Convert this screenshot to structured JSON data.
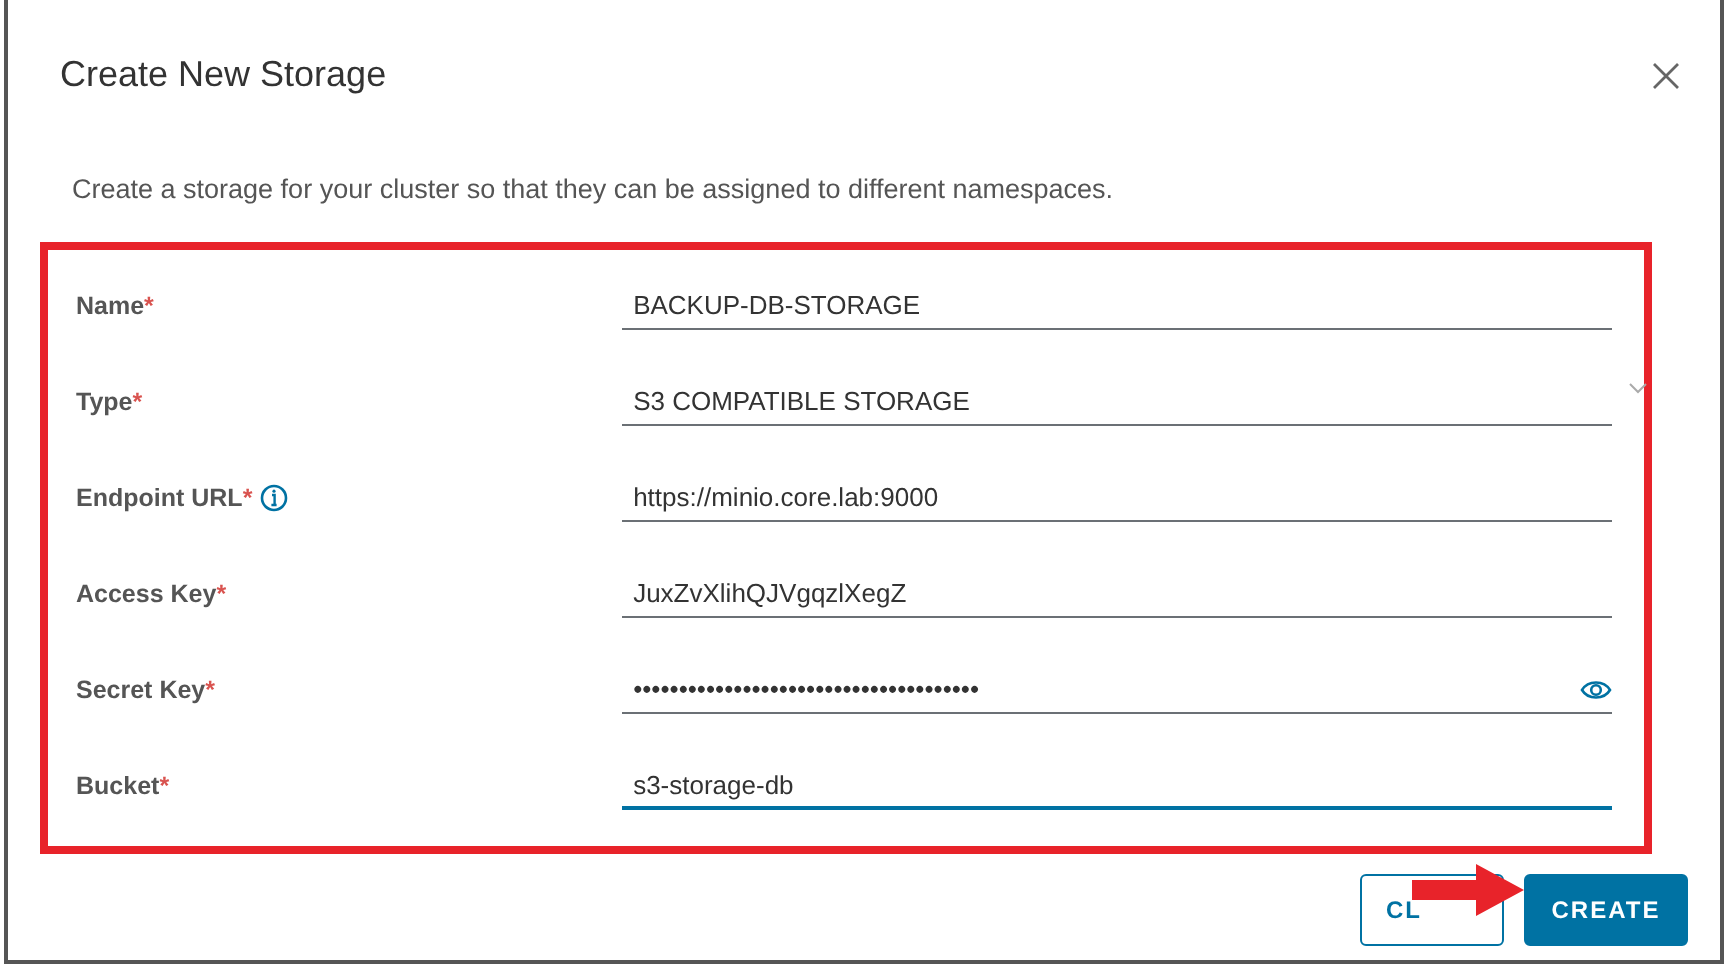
{
  "dialog": {
    "title": "Create New Storage",
    "description": "Create a storage for your cluster so that they can be assigned to different namespaces."
  },
  "fields": [
    {
      "label": "Name",
      "kind": "text",
      "value": "BACKUP-DB-STORAGE",
      "focused": false
    },
    {
      "label": "Type",
      "kind": "select",
      "value": "S3 COMPATIBLE STORAGE",
      "focused": false
    },
    {
      "label": "Endpoint URL",
      "kind": "text",
      "value": "https://minio.core.lab:9000",
      "info": true,
      "focused": false
    },
    {
      "label": "Access Key",
      "kind": "text",
      "value": "JuxZvXlihQJVgqzlXegZ",
      "focused": false
    },
    {
      "label": "Secret Key",
      "kind": "password",
      "value": "••••••••••••••••••••••••••••••••••••••",
      "focused": false
    },
    {
      "label": "Bucket",
      "kind": "text",
      "value": "s3-storage-db",
      "focused": true
    }
  ],
  "required_mark": "*",
  "buttons": [
    {
      "label": "CL",
      "kind": "outline"
    },
    {
      "label": "CREATE",
      "kind": "primary"
    }
  ]
}
